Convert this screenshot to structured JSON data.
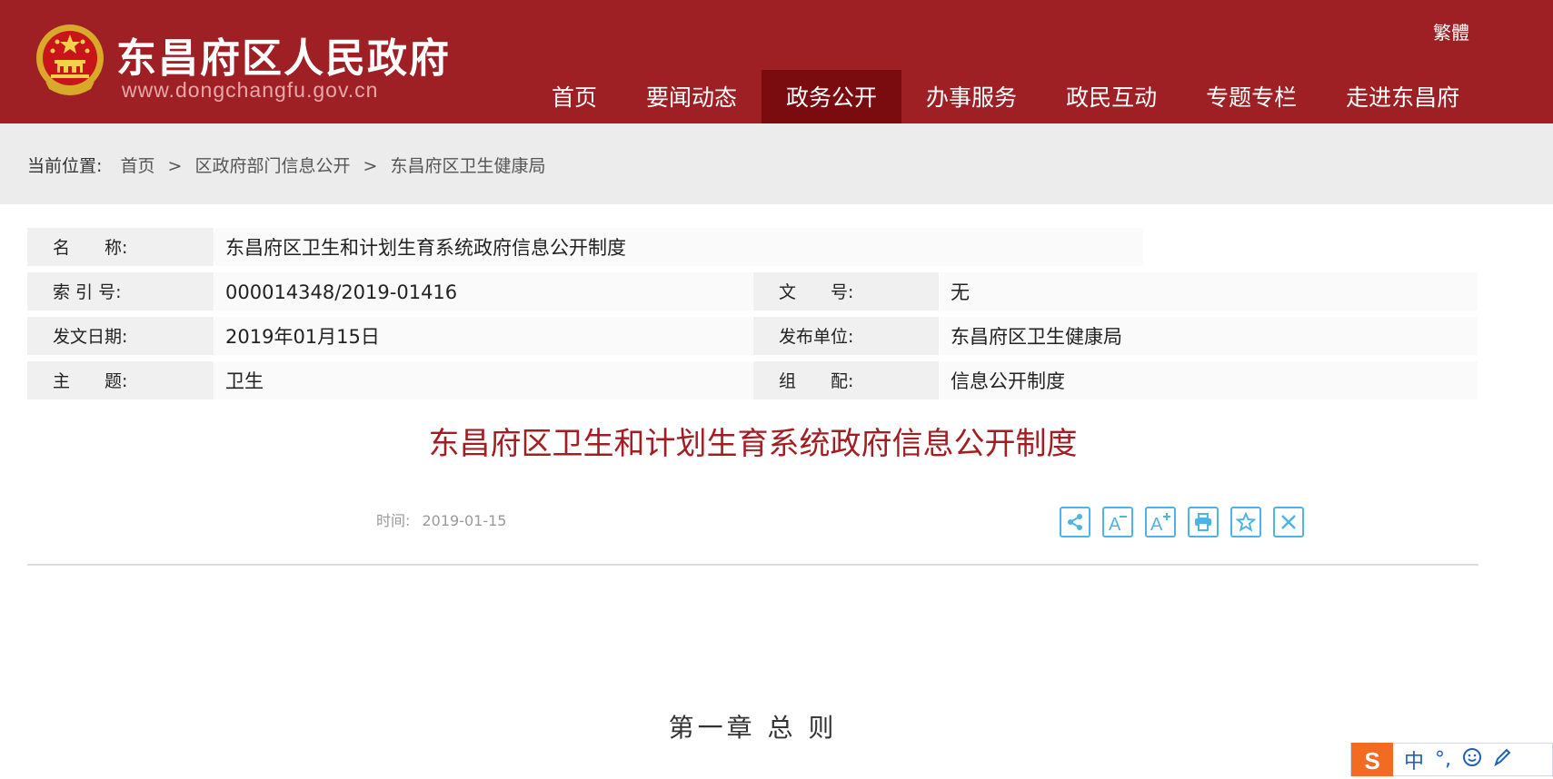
{
  "header": {
    "title": "东昌府区人民政府",
    "url": "www.dongchangfu.gov.cn",
    "traditional_link": "繁體",
    "nav": [
      {
        "label": "首页",
        "active": false
      },
      {
        "label": "要闻动态",
        "active": false
      },
      {
        "label": "政务公开",
        "active": true
      },
      {
        "label": "办事服务",
        "active": false
      },
      {
        "label": "政民互动",
        "active": false
      },
      {
        "label": "专题专栏",
        "active": false
      },
      {
        "label": "走进东昌府",
        "active": false
      }
    ]
  },
  "breadcrumb": {
    "prefix": "当前位置:",
    "items": [
      "首页",
      "区政府部门信息公开",
      "东昌府区卫生健康局"
    ],
    "separator": ">"
  },
  "meta": {
    "name_label": "名　　称:",
    "name_value": "东昌府区卫生和计划生育系统政府信息公开制度",
    "index_label": "索 引 号:",
    "index_value": "000014348/2019-01416",
    "docno_label": "文　　号:",
    "docno_value": "无",
    "date_label": "发文日期:",
    "date_value": "2019年01月15日",
    "publisher_label": "发布单位:",
    "publisher_value": "东昌府区卫生健康局",
    "subject_label": "主　　题:",
    "subject_value": "卫生",
    "category_label": "组　　配:",
    "category_value": "信息公开制度"
  },
  "article": {
    "title": "东昌府区卫生和计划生育系统政府信息公开制度",
    "time_label": "时间:",
    "time_value": "2019-01-15",
    "chapter": "第一章  总  则"
  },
  "tools": [
    "share-icon",
    "font-decrease-icon",
    "font-increase-icon",
    "print-icon",
    "favorite-icon",
    "close-icon"
  ],
  "ime": {
    "logo": "S",
    "lang": "中",
    "punct": "°,"
  },
  "colors": {
    "header_bg": "#9e1f24",
    "nav_active_bg": "#7a0b0f",
    "title_red": "#a31e22",
    "tool_blue": "#4fb3e6"
  }
}
